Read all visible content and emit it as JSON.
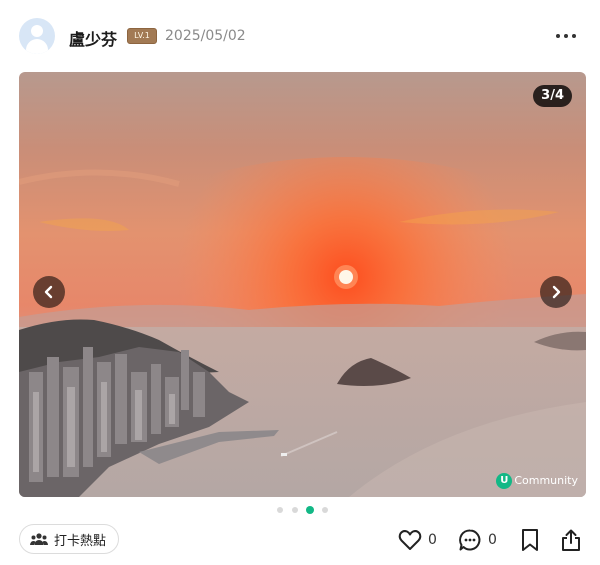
{
  "post": {
    "author": "盧少芬",
    "level_badge": "LV.1",
    "date": "2025/05/02"
  },
  "gallery": {
    "counter": "3/4",
    "current_index": 3,
    "total": 4,
    "watermark": "Community",
    "watermark_logo_letter": "U"
  },
  "footer": {
    "checkin_label": "打卡熱點",
    "like_count": "0",
    "comment_count": "0"
  },
  "colors": {
    "accent": "#12b886",
    "level_badge": "#a27a54"
  },
  "icons": [
    "user-avatar-icon",
    "more-icon",
    "chevron-left-icon",
    "chevron-right-icon",
    "group-icon",
    "heart-icon",
    "comment-icon",
    "bookmark-icon",
    "share-icon"
  ]
}
